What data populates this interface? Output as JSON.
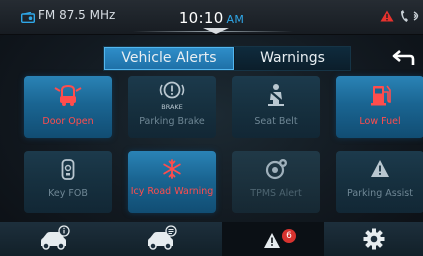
{
  "status": {
    "radio": "FM 87.5 MHz",
    "time": "10:10",
    "ampm": "AM",
    "icons": [
      "radio-icon",
      "warning-icon",
      "phone-icon",
      "signal-icon"
    ]
  },
  "tabs": [
    {
      "label": "Vehicle Alerts",
      "selected": true
    },
    {
      "label": "Warnings",
      "selected": false
    }
  ],
  "tiles": [
    {
      "label": "Door Open",
      "icon": "door-open-icon",
      "state": "active"
    },
    {
      "label": "Parking Brake",
      "icon_text": "BRAKE",
      "icon": "parking-brake-icon",
      "state": "inactive"
    },
    {
      "label": "Seat Belt",
      "icon": "seat-belt-icon",
      "state": "inactive"
    },
    {
      "label": "Low Fuel",
      "icon": "low-fuel-icon",
      "state": "active"
    },
    {
      "label": "Key FOB",
      "icon": "key-fob-icon",
      "state": "inactive"
    },
    {
      "label": "Icy Road Warning",
      "icon": "icy-road-icon",
      "state": "active"
    },
    {
      "label": "TPMS Alert",
      "icon": "tpms-icon",
      "state": "dim"
    },
    {
      "label": "Parking Assist",
      "icon": "parking-assist-icon",
      "state": "inactive"
    }
  ],
  "bottom_nav": {
    "items": [
      "car-info-icon",
      "car-settings-icon",
      "alerts-icon",
      "gear-icon"
    ],
    "alerts_badge": "6",
    "selected": "alerts-icon"
  },
  "colors": {
    "accent": "#2fa7e8",
    "alert_red": "#ff4d4d",
    "tile_active": "#1a6592"
  }
}
